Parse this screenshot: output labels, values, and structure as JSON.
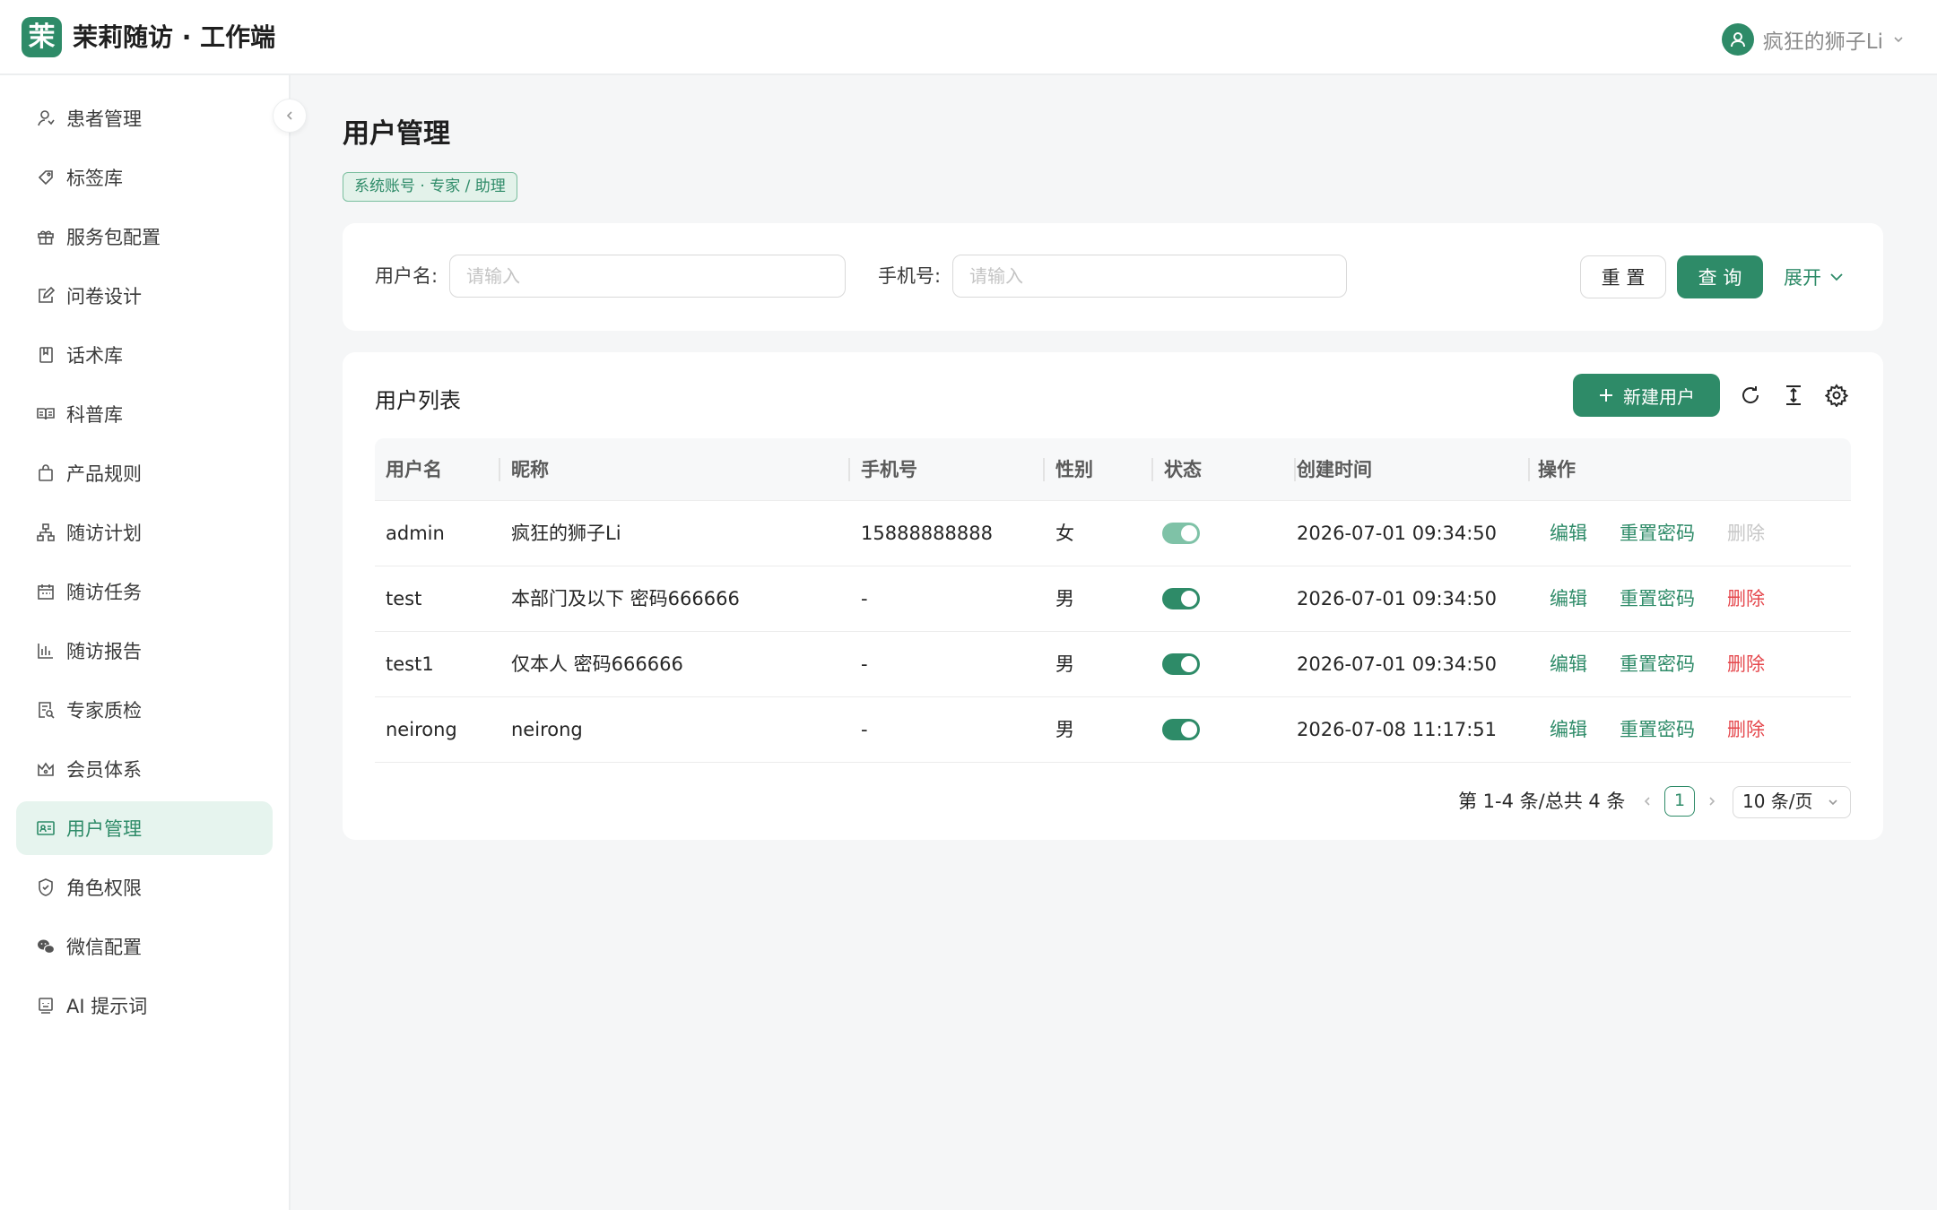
{
  "header": {
    "logo_char": "茉",
    "title": "茉莉随访 · 工作端",
    "user_name": "疯狂的狮子Li",
    "accent": "#2e8b68"
  },
  "sidebar": {
    "items": [
      {
        "label": "患者管理",
        "icon": "patient-icon"
      },
      {
        "label": "标签库",
        "icon": "tag-icon"
      },
      {
        "label": "服务包配置",
        "icon": "gift-icon"
      },
      {
        "label": "问卷设计",
        "icon": "edit-icon"
      },
      {
        "label": "话术库",
        "icon": "book-icon"
      },
      {
        "label": "科普库",
        "icon": "open-book-icon"
      },
      {
        "label": "产品规则",
        "icon": "bag-icon"
      },
      {
        "label": "随访计划",
        "icon": "org-chart-icon"
      },
      {
        "label": "随访任务",
        "icon": "calendar-icon"
      },
      {
        "label": "随访报告",
        "icon": "bar-chart-icon"
      },
      {
        "label": "专家质检",
        "icon": "audit-icon"
      },
      {
        "label": "会员体系",
        "icon": "crown-icon"
      },
      {
        "label": "用户管理",
        "icon": "id-card-icon",
        "active": true
      },
      {
        "label": "角色权限",
        "icon": "shield-icon"
      },
      {
        "label": "微信配置",
        "icon": "wechat-icon"
      },
      {
        "label": "AI 提示词",
        "icon": "robot-icon"
      }
    ]
  },
  "page": {
    "title": "用户管理",
    "tag": "系统账号 · 专家 / 助理"
  },
  "search": {
    "username_label": "用户名:",
    "username_placeholder": "请输入",
    "phone_label": "手机号:",
    "phone_placeholder": "请输入",
    "reset_label": "重 置",
    "query_label": "查 询",
    "expand_label": "展开"
  },
  "table": {
    "title": "用户列表",
    "new_button": "新建用户",
    "columns": [
      "用户名",
      "昵称",
      "手机号",
      "性别",
      "状态",
      "创建时间",
      "操作"
    ],
    "rows": [
      {
        "username": "admin",
        "nickname": "疯狂的狮子Li",
        "phone": "15888888888",
        "gender": "女",
        "status": "on-disabled",
        "created": "2026-07-01 09:34:50",
        "edit": "编辑",
        "reset_pwd": "重置密码",
        "delete": "删除",
        "delete_disabled": true
      },
      {
        "username": "test",
        "nickname": "本部门及以下 密码666666",
        "phone": "-",
        "gender": "男",
        "status": "on",
        "created": "2026-07-01 09:34:50",
        "edit": "编辑",
        "reset_pwd": "重置密码",
        "delete": "删除",
        "delete_disabled": false
      },
      {
        "username": "test1",
        "nickname": "仅本人 密码666666",
        "phone": "-",
        "gender": "男",
        "status": "on",
        "created": "2026-07-01 09:34:50",
        "edit": "编辑",
        "reset_pwd": "重置密码",
        "delete": "删除",
        "delete_disabled": false
      },
      {
        "username": "neirong",
        "nickname": "neirong",
        "phone": "-",
        "gender": "男",
        "status": "on",
        "created": "2026-07-08 11:17:51",
        "edit": "编辑",
        "reset_pwd": "重置密码",
        "delete": "删除",
        "delete_disabled": false
      }
    ]
  },
  "pagination": {
    "total_text": "第 1-4 条/总共 4 条",
    "current_page": "1",
    "page_size": "10 条/页"
  }
}
